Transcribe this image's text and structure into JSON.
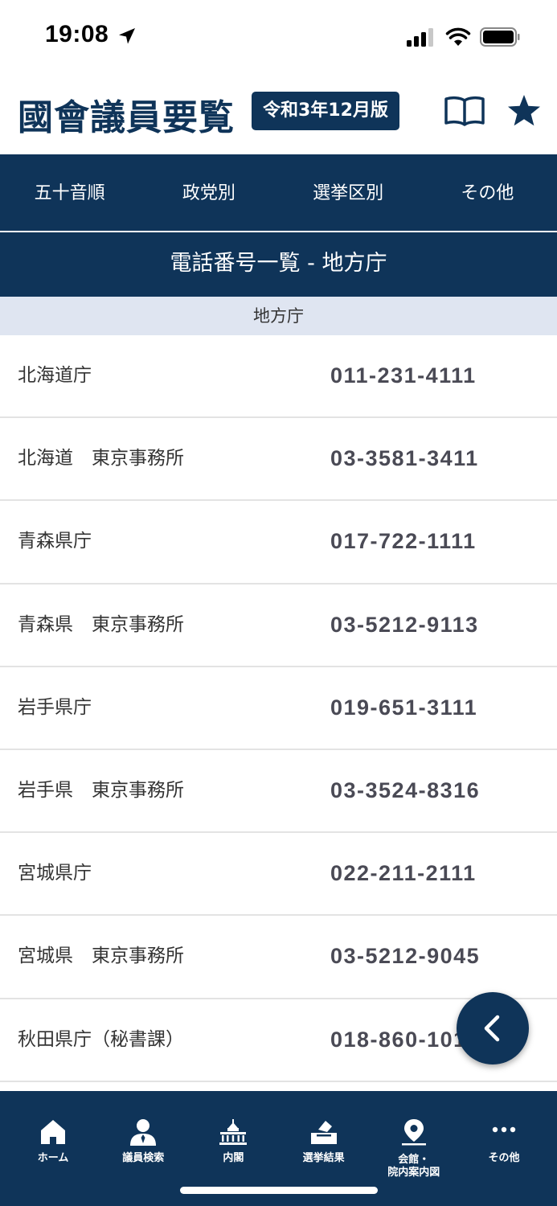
{
  "status_bar": {
    "time": "19:08"
  },
  "header": {
    "title": "國會議員要覧",
    "edition": "令和3年12月版"
  },
  "tabs": [
    {
      "label": "五十音順"
    },
    {
      "label": "政党別"
    },
    {
      "label": "選挙区別"
    },
    {
      "label": "その他"
    }
  ],
  "page_title": "電話番号一覧 - 地方庁",
  "section": {
    "title": "地方庁"
  },
  "items": [
    {
      "name": "北海道庁",
      "phone": "011-231-4111"
    },
    {
      "name": "北海道　東京事務所",
      "phone": "03-3581-3411"
    },
    {
      "name": "青森県庁",
      "phone": "017-722-1111"
    },
    {
      "name": "青森県　東京事務所",
      "phone": "03-5212-9113"
    },
    {
      "name": "岩手県庁",
      "phone": "019-651-3111"
    },
    {
      "name": "岩手県　東京事務所",
      "phone": "03-3524-8316"
    },
    {
      "name": "宮城県庁",
      "phone": "022-211-2111"
    },
    {
      "name": "宮城県　東京事務所",
      "phone": "03-5212-9045"
    },
    {
      "name": "秋田県庁（秘書課）",
      "phone": "018-860-1011"
    }
  ],
  "bottom_nav": [
    {
      "label": "ホーム",
      "icon": "home-icon"
    },
    {
      "label": "議員検索",
      "icon": "person-search-icon"
    },
    {
      "label": "内閣",
      "icon": "diet-building-icon"
    },
    {
      "label": "選挙結果",
      "icon": "ballot-box-icon"
    },
    {
      "label": "会館・\n院内案内図",
      "icon": "map-pin-icon"
    },
    {
      "label": "その他",
      "icon": "more-dots-icon"
    }
  ],
  "colors": {
    "primary": "#0f3459",
    "section_bg": "#dfe5f1",
    "phone_text": "#4a4a55"
  }
}
